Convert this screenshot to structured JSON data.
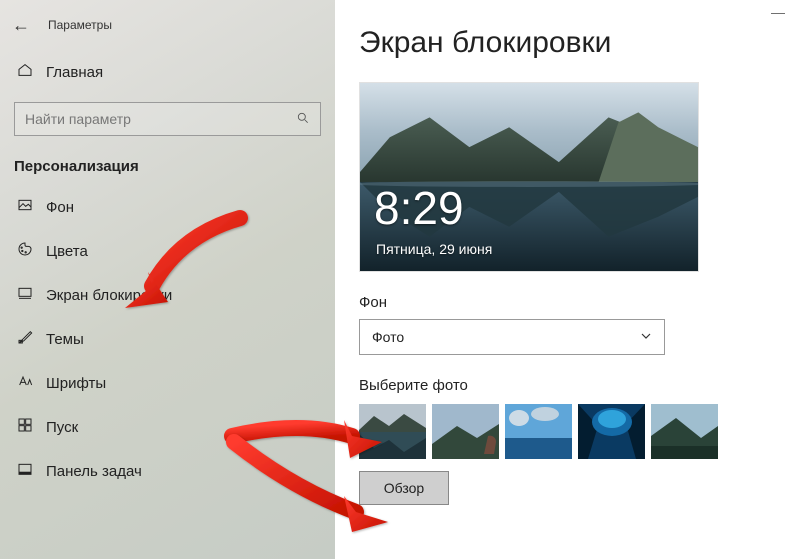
{
  "titlebar": {
    "title": "Параметры"
  },
  "home_label": "Главная",
  "search": {
    "placeholder": "Найти параметр"
  },
  "section_title": "Персонализация",
  "nav": [
    {
      "label": "Фон"
    },
    {
      "label": "Цвета"
    },
    {
      "label": "Экран блокировки"
    },
    {
      "label": "Темы"
    },
    {
      "label": "Шрифты"
    },
    {
      "label": "Пуск"
    },
    {
      "label": "Панель задач"
    }
  ],
  "page_title": "Экран блокировки",
  "preview": {
    "clock": "8:29",
    "date": "Пятница, 29 июня"
  },
  "background_label": "Фон",
  "background_value": "Фото",
  "choose_photo_label": "Выберите фото",
  "browse_label": "Обзор"
}
